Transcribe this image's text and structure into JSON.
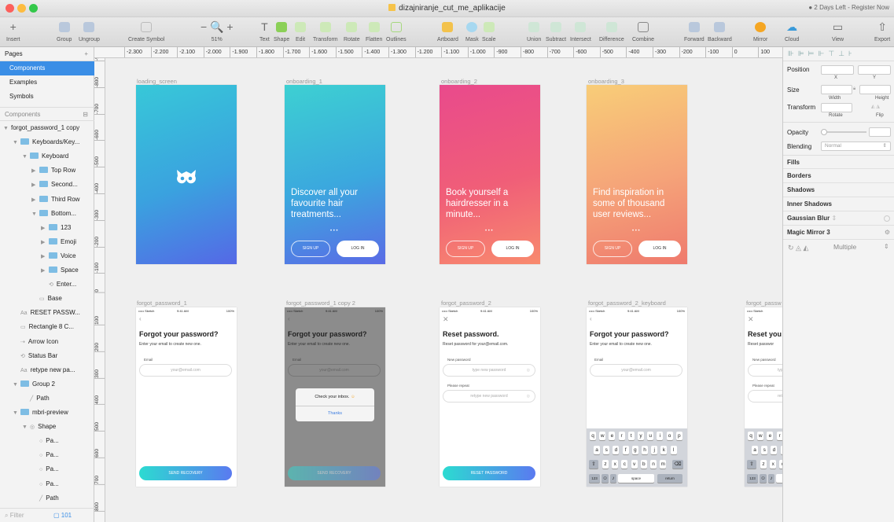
{
  "window": {
    "title": "dizajniranje_cut_me_aplikacije",
    "trial": "2 Days Left - Register Now"
  },
  "toolbar": {
    "items": [
      {
        "label": "Insert"
      },
      {
        "label": "Group"
      },
      {
        "label": "Ungroup"
      },
      {
        "label": "Create Symbol"
      },
      {
        "label": "51%"
      },
      {
        "label": "Text"
      },
      {
        "label": "Shape"
      },
      {
        "label": "Edit"
      },
      {
        "label": "Transform"
      },
      {
        "label": "Rotate"
      },
      {
        "label": "Flatten"
      },
      {
        "label": "Outlines"
      },
      {
        "label": "Artboard"
      },
      {
        "label": "Mask"
      },
      {
        "label": "Scale"
      },
      {
        "label": "Union"
      },
      {
        "label": "Subtract"
      },
      {
        "label": "Intersect"
      },
      {
        "label": "Difference"
      },
      {
        "label": "Combine"
      },
      {
        "label": "Forward"
      },
      {
        "label": "Backward"
      },
      {
        "label": "Mirror"
      },
      {
        "label": "Cloud"
      },
      {
        "label": "View"
      },
      {
        "label": "Export"
      }
    ]
  },
  "left": {
    "pages_label": "Pages",
    "pages": [
      "Components",
      "Examples",
      "Symbols"
    ],
    "section_label": "Components",
    "layers": [
      {
        "label": "forgot_password_1 copy",
        "indent": 0,
        "kind": "board",
        "open": true
      },
      {
        "label": "Keyboards/Key...",
        "indent": 1,
        "kind": "folder",
        "open": true
      },
      {
        "label": "Keyboard",
        "indent": 2,
        "kind": "folder",
        "open": true
      },
      {
        "label": "Top Row",
        "indent": 3,
        "kind": "folder",
        "open": false
      },
      {
        "label": "Second...",
        "indent": 3,
        "kind": "folder",
        "open": false
      },
      {
        "label": "Third Row",
        "indent": 3,
        "kind": "folder",
        "open": false
      },
      {
        "label": "Bottom...",
        "indent": 3,
        "kind": "folder",
        "open": true
      },
      {
        "label": "123",
        "indent": 4,
        "kind": "folder",
        "open": false
      },
      {
        "label": "Emoji",
        "indent": 4,
        "kind": "folder",
        "open": false
      },
      {
        "label": "Voice",
        "indent": 4,
        "kind": "folder",
        "open": false
      },
      {
        "label": "Space",
        "indent": 4,
        "kind": "folder",
        "open": false
      },
      {
        "label": "Enter...",
        "indent": 4,
        "kind": "symbol",
        "open": false
      },
      {
        "label": "Base",
        "indent": 3,
        "kind": "rect",
        "open": false
      },
      {
        "label": "RESET PASSW...",
        "indent": 1,
        "kind": "text",
        "open": false
      },
      {
        "label": "Rectangle 8 C...",
        "indent": 1,
        "kind": "rect",
        "open": false
      },
      {
        "label": "Arrow Icon",
        "indent": 1,
        "kind": "arrow",
        "open": false
      },
      {
        "label": "Status Bar",
        "indent": 1,
        "kind": "symbol",
        "open": false
      },
      {
        "label": "retype new pa...",
        "indent": 1,
        "kind": "text",
        "open": false
      },
      {
        "label": "Group 2",
        "indent": 1,
        "kind": "folder",
        "open": true
      },
      {
        "label": "Path",
        "indent": 2,
        "kind": "path",
        "open": false
      },
      {
        "label": "mbri-preview",
        "indent": 1,
        "kind": "folder",
        "open": true
      },
      {
        "label": "Shape",
        "indent": 2,
        "kind": "shape",
        "open": true
      },
      {
        "label": "Pa...",
        "indent": 3,
        "kind": "oval",
        "open": false
      },
      {
        "label": "Pa...",
        "indent": 3,
        "kind": "oval",
        "open": false
      },
      {
        "label": "Pa...",
        "indent": 3,
        "kind": "oval",
        "open": false
      },
      {
        "label": "Pa...",
        "indent": 3,
        "kind": "oval",
        "open": false
      },
      {
        "label": "Path",
        "indent": 3,
        "kind": "path",
        "open": false
      }
    ],
    "filter_placeholder": "Filter",
    "filter_count": "101"
  },
  "rulers": {
    "h": [
      "-2.300",
      "-2.200",
      "-2.100",
      "-2.000",
      "-1.900",
      "-1.800",
      "-1.700",
      "-1.600",
      "-1.500",
      "-1.400",
      "-1.300",
      "-1.200",
      "-1.100",
      "-1.000",
      "-900",
      "-800",
      "-700",
      "-600",
      "-500",
      "-400",
      "-300",
      "-200",
      "-100",
      "0",
      "100"
    ],
    "v": [
      "-900",
      "-800",
      "-700",
      "-600",
      "-500",
      "-400",
      "-300",
      "-200",
      "-100",
      "0",
      "100",
      "200",
      "300",
      "400",
      "500",
      "600",
      "700",
      "800"
    ]
  },
  "artboards": {
    "loading": {
      "name": "loading_screen"
    },
    "ob1": {
      "name": "onboarding_1",
      "text": "Discover all your favourite hair treatments...",
      "signup": "SIGN UP",
      "login": "LOG IN"
    },
    "ob2": {
      "name": "onboarding_2",
      "text": "Book yourself a hairdresser in a minute...",
      "signup": "SIGN UP",
      "login": "LOG IN"
    },
    "ob3": {
      "name": "onboarding_3",
      "text": "Find inspiration in some of thousand user reviews...",
      "signup": "SIGN UP",
      "login": "LOG IN"
    },
    "fp1": {
      "name": "forgot_password_1",
      "title": "Forgot your password?",
      "sub": "Enter your email to create new one.",
      "label": "Email",
      "placeholder": "your@email.com",
      "button": "SEND RECOVERY"
    },
    "fp1c": {
      "name": "forgot_password_1 copy 2",
      "title": "Forgot your password?",
      "sub": "Enter your email to create new one.",
      "label": "Email",
      "placeholder": "your@email.com",
      "button": "SEND RECOVERY",
      "dialog": "Check your inbox.",
      "dialog_btn": "Thanks"
    },
    "fp2": {
      "name": "forgot_password_2",
      "title": "Reset password.",
      "sub": "Reset password for your@email.com.",
      "label1": "New password",
      "ph1": "type new password",
      "label2": "Please repeat",
      "ph2": "retype new password",
      "button": "RESET PASSWORD"
    },
    "fp2k": {
      "name": "forgot_password_2_keyboard",
      "title": "Forgot your password?",
      "sub": "Enter your email to create new one.",
      "label": "Email",
      "placeholder": "your@email.com"
    },
    "fp3": {
      "name": "forgot_passw",
      "title": "Reset you",
      "sub": "Reset passwor",
      "label1": "New password",
      "label2": "Please repeat",
      "ph1": "type",
      "ph2": "retyp"
    },
    "status": {
      "carrier": "••••• Sketch",
      "time": "9:41 AM",
      "battery": "100%"
    },
    "keyboard": {
      "row1": [
        "q",
        "w",
        "e",
        "r",
        "t",
        "y",
        "u",
        "i",
        "o",
        "p"
      ],
      "row2": [
        "a",
        "s",
        "d",
        "f",
        "g",
        "h",
        "j",
        "k",
        "l"
      ],
      "row3": [
        "z",
        "x",
        "c",
        "v",
        "b",
        "n",
        "m"
      ],
      "num": "123",
      "space": "space",
      "ret": "return"
    }
  },
  "right": {
    "position": "Position",
    "x": "X",
    "y": "Y",
    "size": "Size",
    "width": "Width",
    "height": "Height",
    "transform": "Transform",
    "rotate": "Rotate",
    "flip": "Flip",
    "opacity": "Opacity",
    "blending": "Blending",
    "blending_value": "Normal",
    "fills": "Fills",
    "borders": "Borders",
    "shadows": "Shadows",
    "inner_shadows": "Inner Shadows",
    "blur": "Gaussian Blur",
    "mirror": "Magic Mirror 3",
    "multiple": "Multiple"
  }
}
